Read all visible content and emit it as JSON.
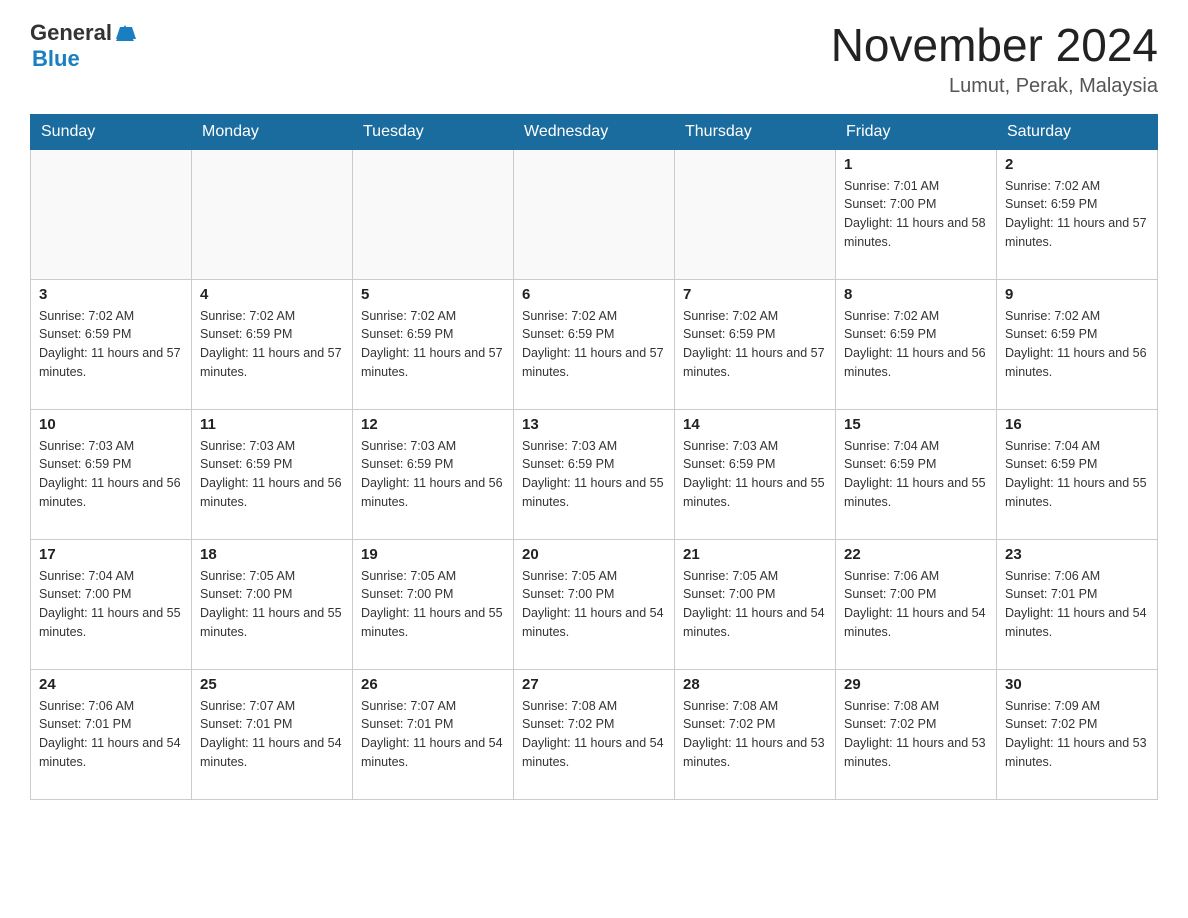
{
  "header": {
    "logo_general": "General",
    "logo_blue": "Blue",
    "month_title": "November 2024",
    "location": "Lumut, Perak, Malaysia"
  },
  "weekdays": [
    "Sunday",
    "Monday",
    "Tuesday",
    "Wednesday",
    "Thursday",
    "Friday",
    "Saturday"
  ],
  "weeks": [
    [
      {
        "day": "",
        "info": ""
      },
      {
        "day": "",
        "info": ""
      },
      {
        "day": "",
        "info": ""
      },
      {
        "day": "",
        "info": ""
      },
      {
        "day": "",
        "info": ""
      },
      {
        "day": "1",
        "info": "Sunrise: 7:01 AM\nSunset: 7:00 PM\nDaylight: 11 hours and 58 minutes."
      },
      {
        "day": "2",
        "info": "Sunrise: 7:02 AM\nSunset: 6:59 PM\nDaylight: 11 hours and 57 minutes."
      }
    ],
    [
      {
        "day": "3",
        "info": "Sunrise: 7:02 AM\nSunset: 6:59 PM\nDaylight: 11 hours and 57 minutes."
      },
      {
        "day": "4",
        "info": "Sunrise: 7:02 AM\nSunset: 6:59 PM\nDaylight: 11 hours and 57 minutes."
      },
      {
        "day": "5",
        "info": "Sunrise: 7:02 AM\nSunset: 6:59 PM\nDaylight: 11 hours and 57 minutes."
      },
      {
        "day": "6",
        "info": "Sunrise: 7:02 AM\nSunset: 6:59 PM\nDaylight: 11 hours and 57 minutes."
      },
      {
        "day": "7",
        "info": "Sunrise: 7:02 AM\nSunset: 6:59 PM\nDaylight: 11 hours and 57 minutes."
      },
      {
        "day": "8",
        "info": "Sunrise: 7:02 AM\nSunset: 6:59 PM\nDaylight: 11 hours and 56 minutes."
      },
      {
        "day": "9",
        "info": "Sunrise: 7:02 AM\nSunset: 6:59 PM\nDaylight: 11 hours and 56 minutes."
      }
    ],
    [
      {
        "day": "10",
        "info": "Sunrise: 7:03 AM\nSunset: 6:59 PM\nDaylight: 11 hours and 56 minutes."
      },
      {
        "day": "11",
        "info": "Sunrise: 7:03 AM\nSunset: 6:59 PM\nDaylight: 11 hours and 56 minutes."
      },
      {
        "day": "12",
        "info": "Sunrise: 7:03 AM\nSunset: 6:59 PM\nDaylight: 11 hours and 56 minutes."
      },
      {
        "day": "13",
        "info": "Sunrise: 7:03 AM\nSunset: 6:59 PM\nDaylight: 11 hours and 55 minutes."
      },
      {
        "day": "14",
        "info": "Sunrise: 7:03 AM\nSunset: 6:59 PM\nDaylight: 11 hours and 55 minutes."
      },
      {
        "day": "15",
        "info": "Sunrise: 7:04 AM\nSunset: 6:59 PM\nDaylight: 11 hours and 55 minutes."
      },
      {
        "day": "16",
        "info": "Sunrise: 7:04 AM\nSunset: 6:59 PM\nDaylight: 11 hours and 55 minutes."
      }
    ],
    [
      {
        "day": "17",
        "info": "Sunrise: 7:04 AM\nSunset: 7:00 PM\nDaylight: 11 hours and 55 minutes."
      },
      {
        "day": "18",
        "info": "Sunrise: 7:05 AM\nSunset: 7:00 PM\nDaylight: 11 hours and 55 minutes."
      },
      {
        "day": "19",
        "info": "Sunrise: 7:05 AM\nSunset: 7:00 PM\nDaylight: 11 hours and 55 minutes."
      },
      {
        "day": "20",
        "info": "Sunrise: 7:05 AM\nSunset: 7:00 PM\nDaylight: 11 hours and 54 minutes."
      },
      {
        "day": "21",
        "info": "Sunrise: 7:05 AM\nSunset: 7:00 PM\nDaylight: 11 hours and 54 minutes."
      },
      {
        "day": "22",
        "info": "Sunrise: 7:06 AM\nSunset: 7:00 PM\nDaylight: 11 hours and 54 minutes."
      },
      {
        "day": "23",
        "info": "Sunrise: 7:06 AM\nSunset: 7:01 PM\nDaylight: 11 hours and 54 minutes."
      }
    ],
    [
      {
        "day": "24",
        "info": "Sunrise: 7:06 AM\nSunset: 7:01 PM\nDaylight: 11 hours and 54 minutes."
      },
      {
        "day": "25",
        "info": "Sunrise: 7:07 AM\nSunset: 7:01 PM\nDaylight: 11 hours and 54 minutes."
      },
      {
        "day": "26",
        "info": "Sunrise: 7:07 AM\nSunset: 7:01 PM\nDaylight: 11 hours and 54 minutes."
      },
      {
        "day": "27",
        "info": "Sunrise: 7:08 AM\nSunset: 7:02 PM\nDaylight: 11 hours and 54 minutes."
      },
      {
        "day": "28",
        "info": "Sunrise: 7:08 AM\nSunset: 7:02 PM\nDaylight: 11 hours and 53 minutes."
      },
      {
        "day": "29",
        "info": "Sunrise: 7:08 AM\nSunset: 7:02 PM\nDaylight: 11 hours and 53 minutes."
      },
      {
        "day": "30",
        "info": "Sunrise: 7:09 AM\nSunset: 7:02 PM\nDaylight: 11 hours and 53 minutes."
      }
    ]
  ]
}
